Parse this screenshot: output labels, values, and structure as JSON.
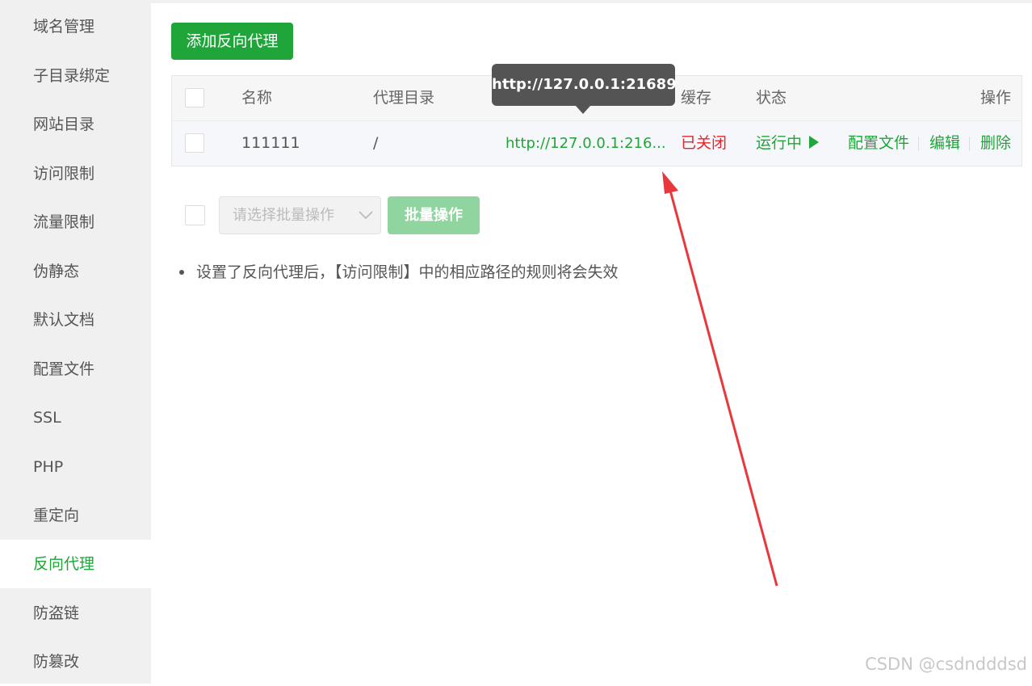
{
  "sidebar": {
    "items": [
      {
        "label": "域名管理"
      },
      {
        "label": "子目录绑定"
      },
      {
        "label": "网站目录"
      },
      {
        "label": "访问限制"
      },
      {
        "label": "流量限制"
      },
      {
        "label": "伪静态"
      },
      {
        "label": "默认文档"
      },
      {
        "label": "配置文件"
      },
      {
        "label": "SSL"
      },
      {
        "label": "PHP"
      },
      {
        "label": "重定向"
      },
      {
        "label": "反向代理",
        "active": true
      },
      {
        "label": "防盗链"
      },
      {
        "label": "防篡改"
      }
    ]
  },
  "toolbar": {
    "add_label": "添加反向代理"
  },
  "table": {
    "headers": {
      "name": "名称",
      "proxy_dir": "代理目录",
      "cache": "缓存",
      "status": "状态",
      "actions": "操作"
    },
    "rows": [
      {
        "name": "111111",
        "proxy_dir": "/",
        "target_url": "http://127.0.0.1:216...",
        "cache": "已关闭",
        "status": "运行中",
        "status_icon": "play-icon",
        "actions": [
          "配置文件",
          "编辑",
          "删除"
        ]
      }
    ]
  },
  "tooltip": {
    "text": "http://127.0.0.1:21689"
  },
  "batch": {
    "select_placeholder": "请选择批量操作",
    "button_label": "批量操作"
  },
  "note": {
    "text": "设置了反向代理后，【访问限制】中的相应路径的规则将会失效"
  },
  "watermark": "CSDN @csdndddsd",
  "colors": {
    "accent": "#20a53a",
    "danger": "#e0262e",
    "tooltip_bg": "#545454",
    "annotation_arrow": "#e8383d"
  }
}
